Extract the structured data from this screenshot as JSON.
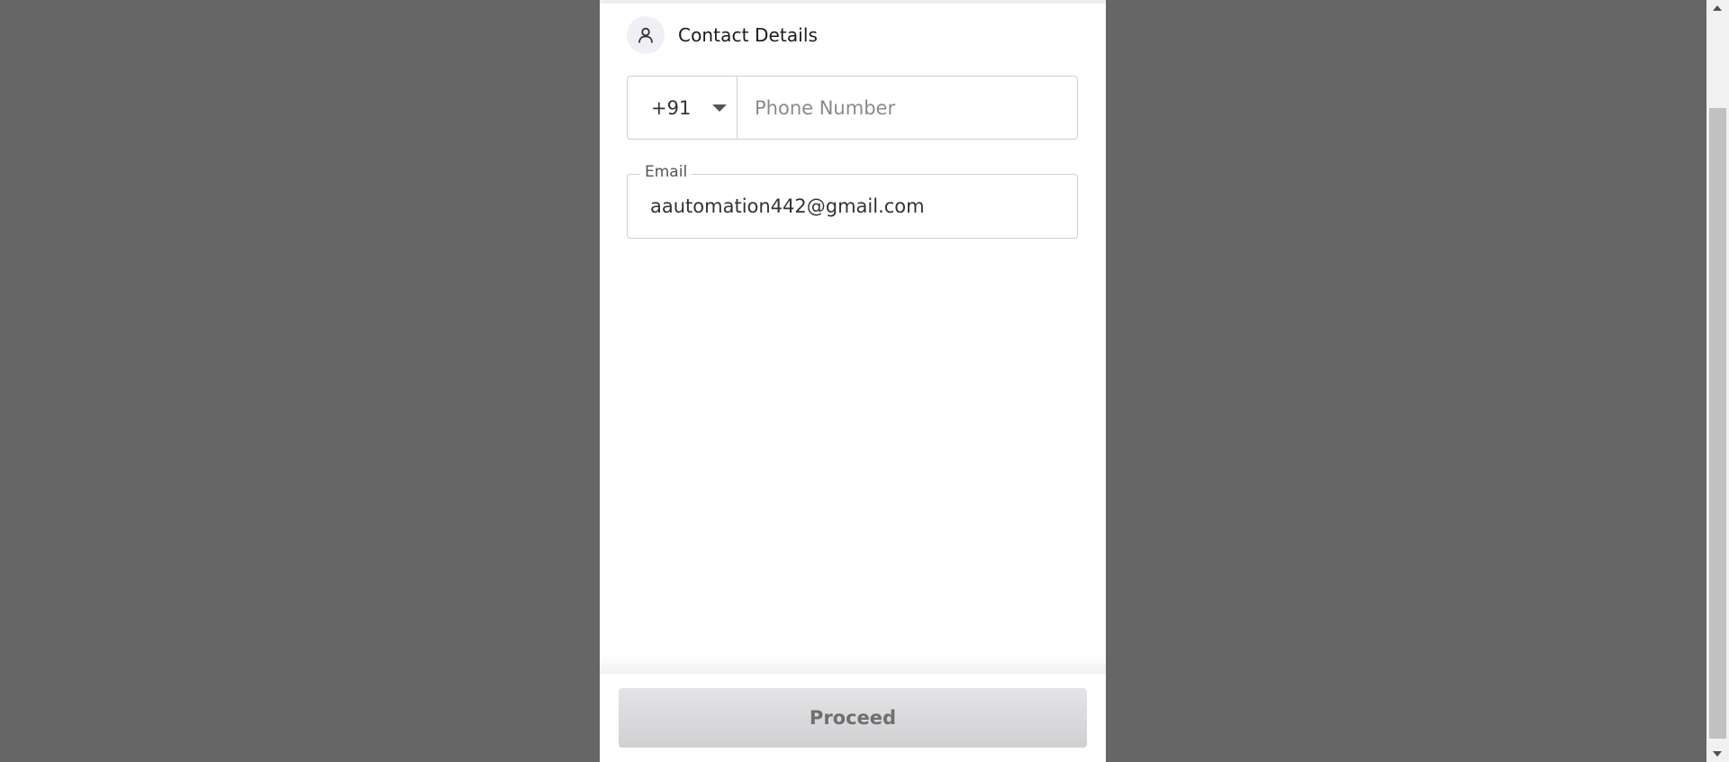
{
  "header": {
    "title": "Contact Details",
    "icon": "user-icon"
  },
  "phone": {
    "country_code": "+91",
    "placeholder": "Phone Number",
    "value": ""
  },
  "email": {
    "label": "Email",
    "value": "aautomation442@gmail.com"
  },
  "footer": {
    "proceed_label": "Proceed"
  },
  "colors": {
    "overlay": "#666666",
    "panel": "#ffffff",
    "border": "#cfcfcf",
    "button_disabled": "#d9d9db"
  }
}
